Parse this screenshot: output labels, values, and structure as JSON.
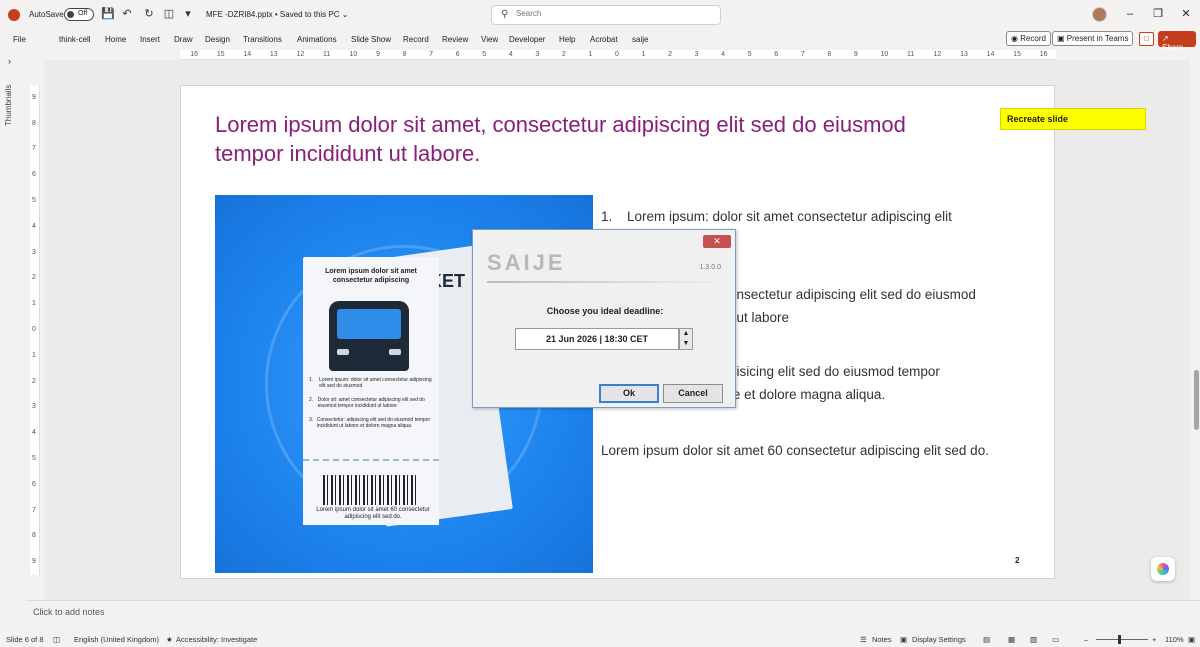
{
  "titlebar": {
    "autosave_label": "AutoSave",
    "autosave_state": "Off",
    "document_title": "MFE -DZRI84.pptx • Saved to this PC ⌄"
  },
  "search": {
    "placeholder": "Search"
  },
  "ribbon": {
    "tabs": [
      "File",
      "think-cell",
      "Home",
      "Insert",
      "Draw",
      "Design",
      "Transitions",
      "Animations",
      "Slide Show",
      "Record",
      "Review",
      "View",
      "Developer",
      "Help",
      "Acrobat",
      "saije"
    ],
    "record_label": "Record",
    "present_teams_label": "Present in Teams",
    "share_label": "Share"
  },
  "ruler_top": [
    "16",
    "15",
    "14",
    "13",
    "12",
    "11",
    "10",
    "9",
    "8",
    "7",
    "6",
    "5",
    "4",
    "3",
    "2",
    "1",
    "0",
    "1",
    "2",
    "3",
    "4",
    "5",
    "6",
    "7",
    "8",
    "9",
    "10",
    "11",
    "12",
    "13",
    "14",
    "15",
    "16"
  ],
  "ruler_left": [
    "9",
    "8",
    "7",
    "6",
    "5",
    "4",
    "3",
    "2",
    "1",
    "0",
    "1",
    "2",
    "3",
    "4",
    "5",
    "6",
    "7",
    "8",
    "9"
  ],
  "thumbnails_label": "Thumbnails",
  "slide": {
    "title": "Lorem ipsum dolor sit amet, consectetur adipiscing elit sed do eiusmod tempor incididunt ut labore.",
    "sticky_note": "Recreate slide",
    "ticket": {
      "title": "Lorem ipsum dolor sit amet consectetur adipiscing",
      "items": [
        {
          "num": "1.",
          "text": "Lorem ipsum: dolor sit amet consectetur adipiscing elit sed do eiusmod"
        },
        {
          "num": "2.",
          "text": "Dolor sit: amet consectetur adipiscing elit sed do eiusmod tempor incididunt ut labore"
        },
        {
          "num": "3.",
          "text": "Consectetur: adipiscing elit sed do eiusmod tempor incididunt ut labore et dolore magna aliqua."
        }
      ],
      "stub_text": "Lorem ipsum dolor sit amet 60 consectetur adipiscing elit sed do.",
      "ket_text": "KET"
    },
    "bullets": [
      {
        "num": "1.",
        "text": "Lorem ipsum: dolor sit amet consectetur adipiscing elit"
      },
      {
        "num": "",
        "text": "onsectetur adipiscing elit sed do eiusmod"
      },
      {
        "num": "",
        "text": "t ut labore"
      },
      {
        "num": "",
        "text": "pisicing elit sed do eiusmod tempor"
      },
      {
        "num": "",
        "text": "incididunt ut labore et dolore magna aliqua."
      }
    ],
    "footer_text": "Lorem ipsum dolor sit amet 60 consectetur adipiscing elit sed do.",
    "slide_number": "2"
  },
  "dialog": {
    "logo": "SAIJE",
    "version": "1.3.0.0",
    "prompt": "Choose you ideal deadline:",
    "date_value": "21 Jun 2026 | 18:30 CET",
    "ok_label": "Ok",
    "cancel_label": "Cancel",
    "close_glyph": "✕"
  },
  "notes_placeholder": "Click to add notes",
  "statusbar": {
    "slide_info": "Slide 6 of 8",
    "language": "English (United Kingdom)",
    "accessibility": "Accessibility: Investigate",
    "notes": "Notes",
    "display_settings": "Display Settings",
    "zoom": "110%"
  }
}
